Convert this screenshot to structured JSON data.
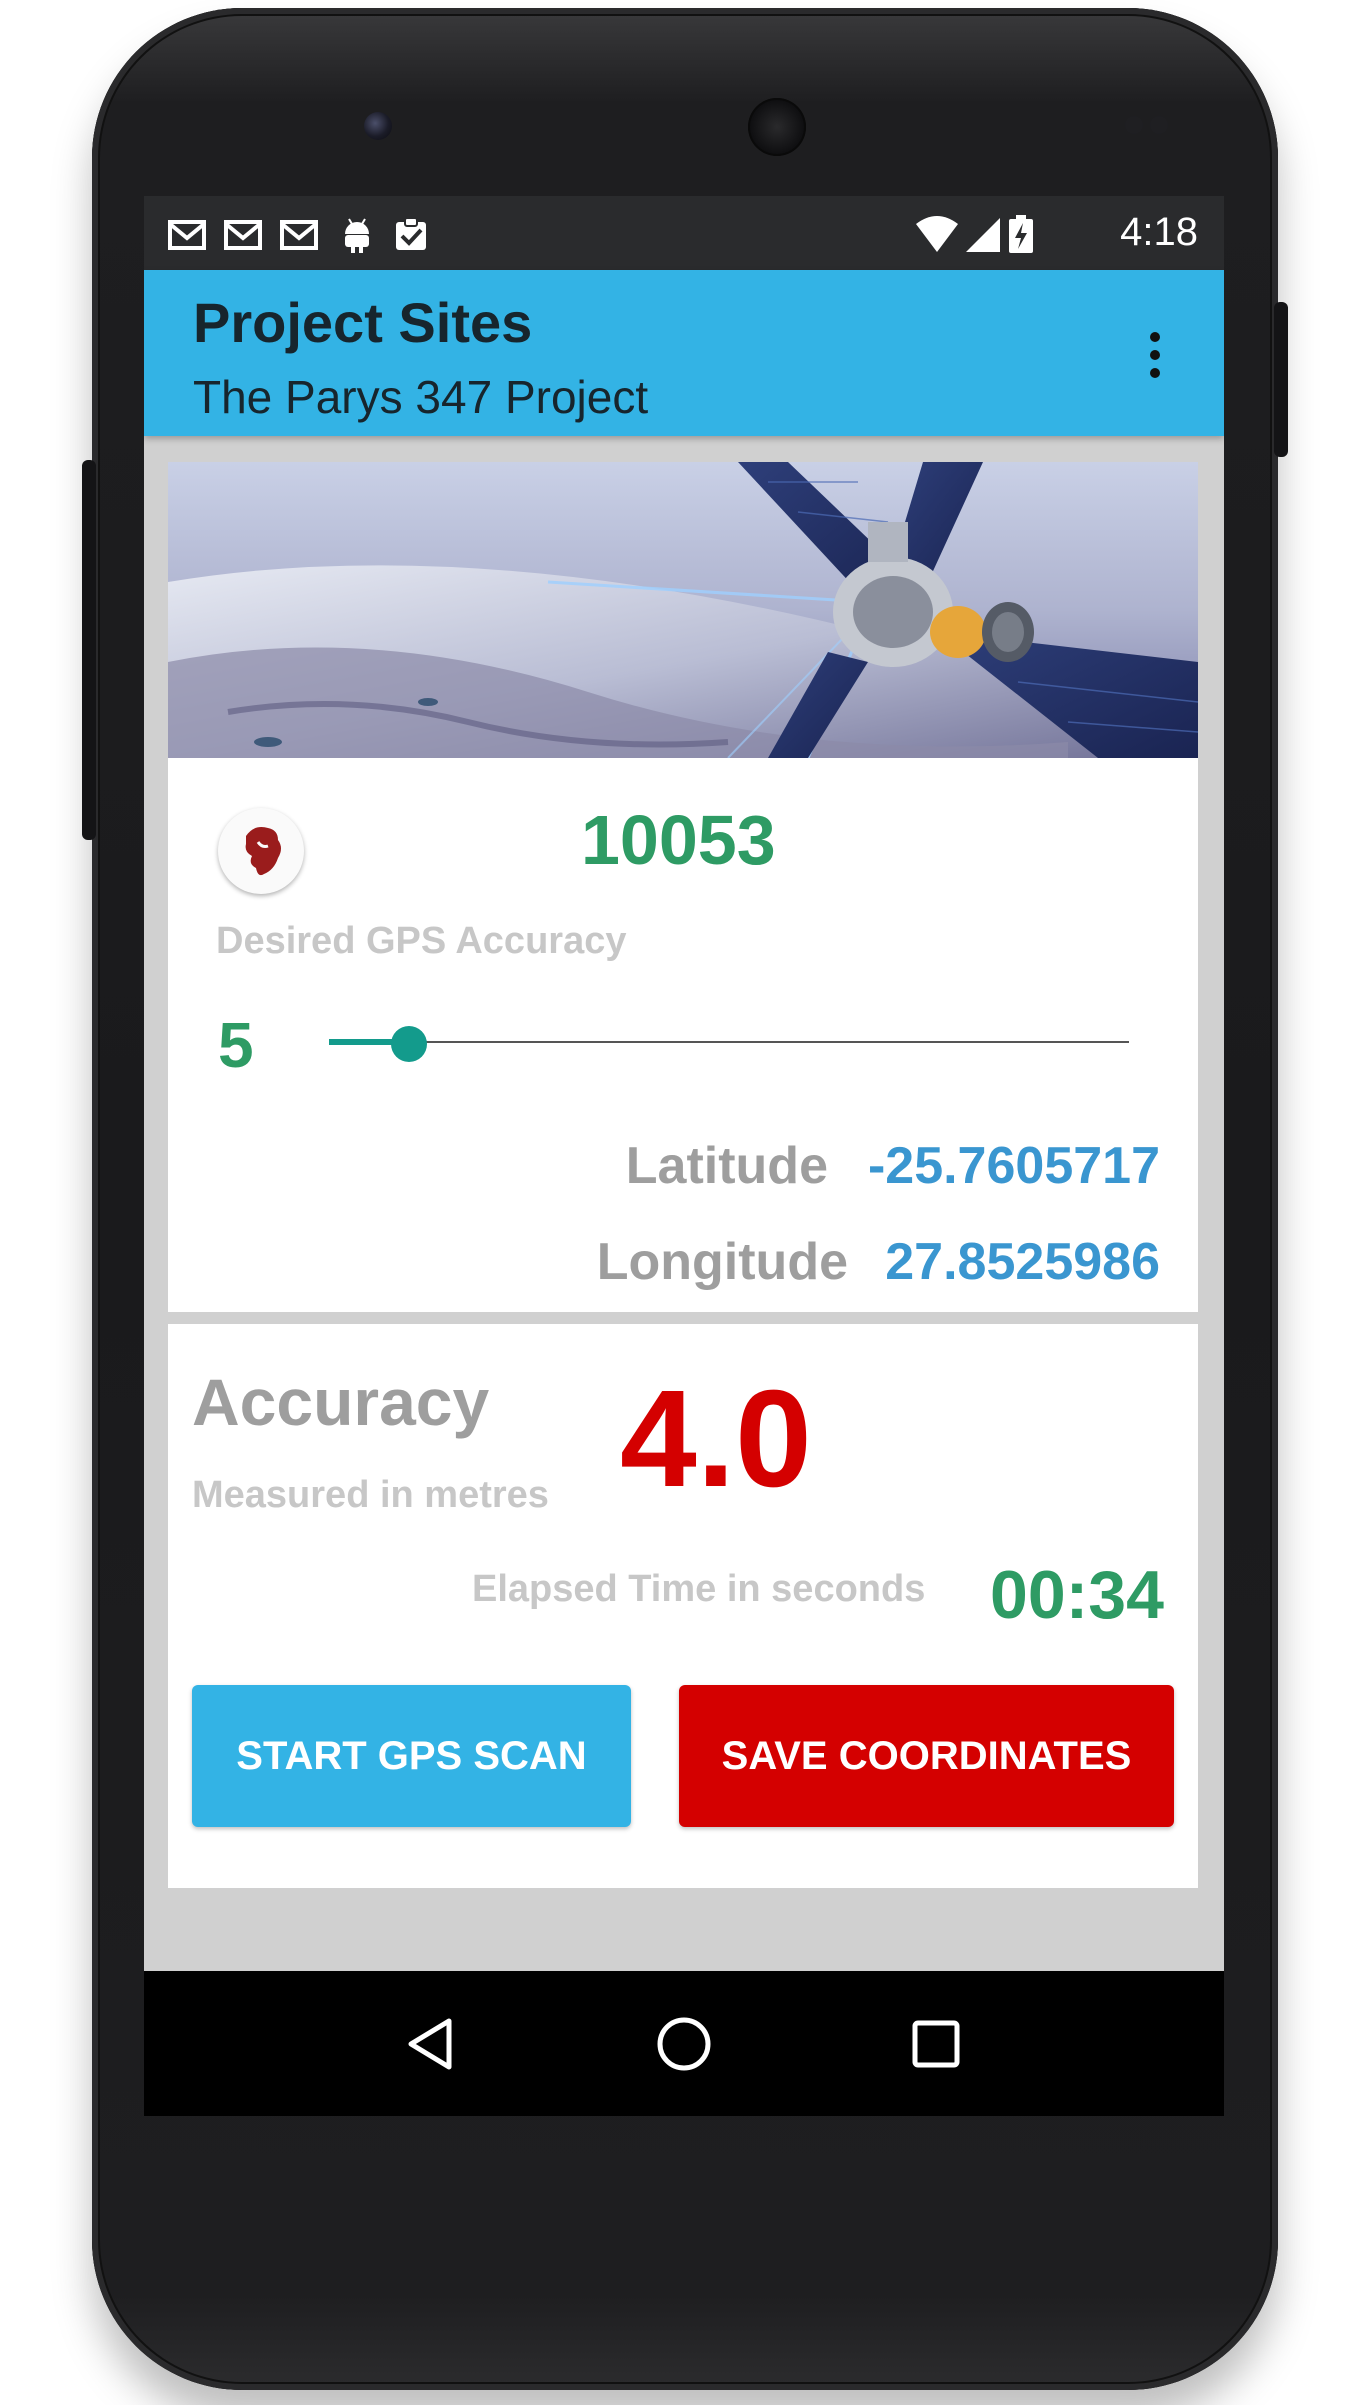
{
  "status_bar": {
    "time": "4:18",
    "left_icons": [
      "gmail-icon",
      "gmail-icon",
      "gmail-icon",
      "android-icon",
      "clipboard-check-icon"
    ],
    "right_icons": [
      "wifi-icon",
      "cell-signal-icon",
      "battery-charging-icon"
    ]
  },
  "app_bar": {
    "title": "Project Sites",
    "subtitle": "The Parys 347 Project",
    "overflow_icon": "more-vert-icon",
    "color": "#33b3e5"
  },
  "gps_card": {
    "hero_image": "satellite-over-earth",
    "site_id": "10053",
    "desired_accuracy_label": "Desired GPS Accuracy",
    "desired_accuracy_value": "5",
    "slider_fraction": 0.1,
    "latitude_label": "Latitude",
    "latitude_value": "-25.7605717",
    "longitude_label": "Longitude",
    "longitude_value": "27.8525986"
  },
  "accuracy_card": {
    "title": "Accuracy",
    "subtitle": "Measured in metres",
    "value": "4.0",
    "elapsed_label": "Elapsed Time in seconds",
    "elapsed_value": "00:34",
    "start_button": "START GPS SCAN",
    "save_button": "SAVE COORDINATES"
  },
  "colors": {
    "accent_blue": "#33b3e5",
    "accent_red": "#d40000",
    "accent_green": "#2e9b64",
    "coordinate_blue": "#3a96d0"
  },
  "nav_bar": {
    "icons": [
      "back-icon",
      "home-icon",
      "recents-icon"
    ]
  }
}
